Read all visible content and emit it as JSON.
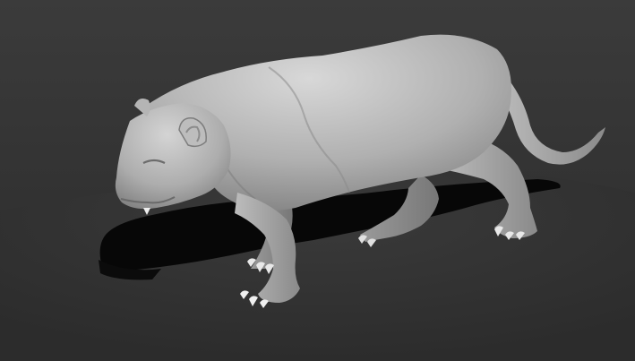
{
  "scene": {
    "subject_icon": "panther-icon",
    "colors": {
      "background_top": "#3a3a3a",
      "background_horizon": "#2c2c2c",
      "ground": "#333333",
      "shadow": "#060606",
      "model_light": "#d6d6d6",
      "model_mid": "#a9a9a9",
      "model_dark": "#6e6e6e",
      "claw": "#f2f2f2"
    }
  }
}
